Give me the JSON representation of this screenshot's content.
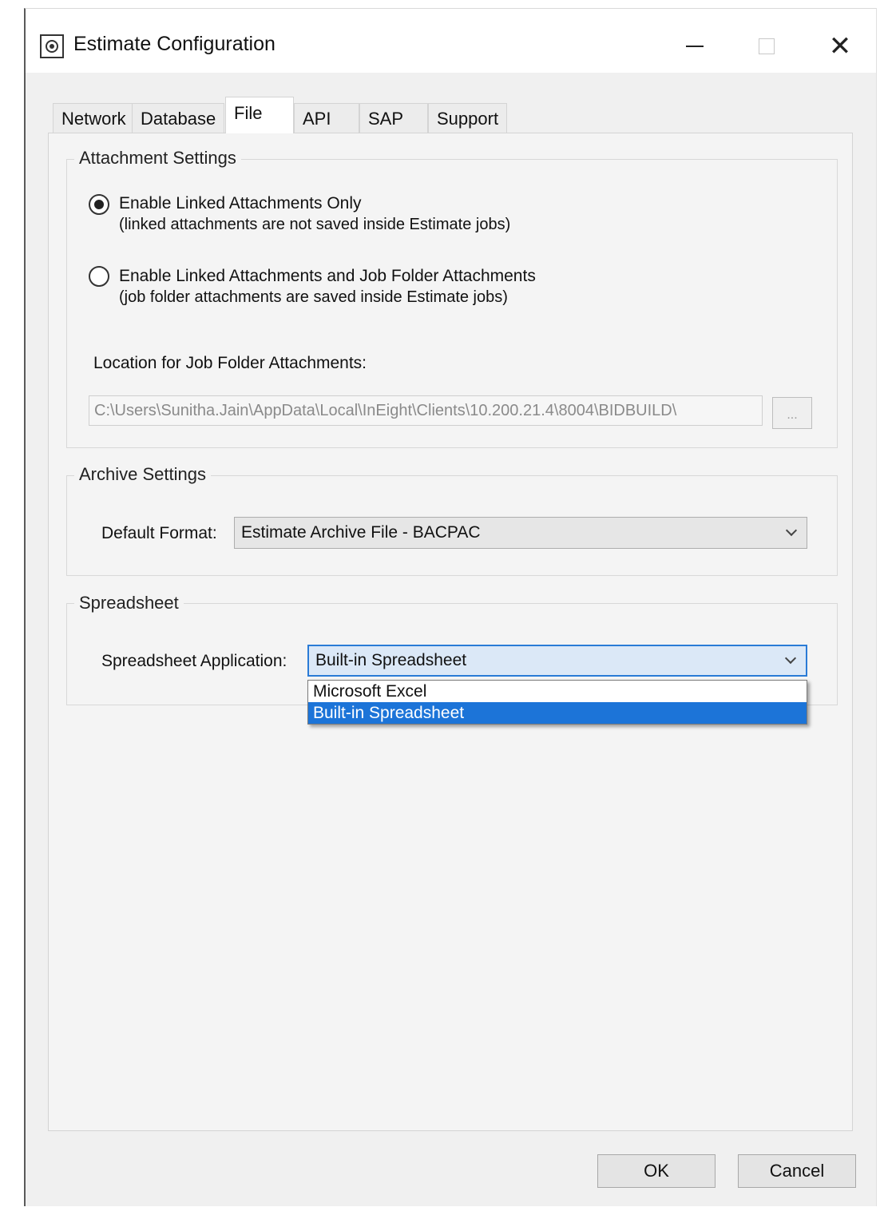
{
  "window": {
    "title": "Estimate Configuration"
  },
  "tabs": [
    {
      "label": "Network"
    },
    {
      "label": "Database"
    },
    {
      "label": "File",
      "active": true
    },
    {
      "label": "API"
    },
    {
      "label": "SAP"
    },
    {
      "label": "Support"
    }
  ],
  "attachment_settings": {
    "legend": "Attachment Settings",
    "option1": {
      "label": "Enable Linked Attachments Only",
      "note": "(linked attachments are not saved inside Estimate jobs)",
      "checked": true
    },
    "option2": {
      "label": "Enable Linked Attachments and Job Folder Attachments",
      "note": "(job folder attachments are saved inside Estimate jobs)",
      "checked": false
    },
    "location_label": "Location for Job Folder Attachments:",
    "location_value": "C:\\Users\\Sunitha.Jain\\AppData\\Local\\InEight\\Clients\\10.200.21.4\\8004\\BIDBUILD\\",
    "browse_label": "..."
  },
  "archive_settings": {
    "legend": "Archive Settings",
    "default_format_label": "Default Format:",
    "default_format_value": "Estimate Archive File - BACPAC"
  },
  "spreadsheet": {
    "legend": "Spreadsheet",
    "app_label": "Spreadsheet Application:",
    "app_value": "Built-in Spreadsheet",
    "options": [
      "Microsoft Excel",
      "Built-in Spreadsheet"
    ],
    "highlighted_option": "Built-in Spreadsheet"
  },
  "footer": {
    "ok_label": "OK",
    "cancel_label": "Cancel"
  }
}
